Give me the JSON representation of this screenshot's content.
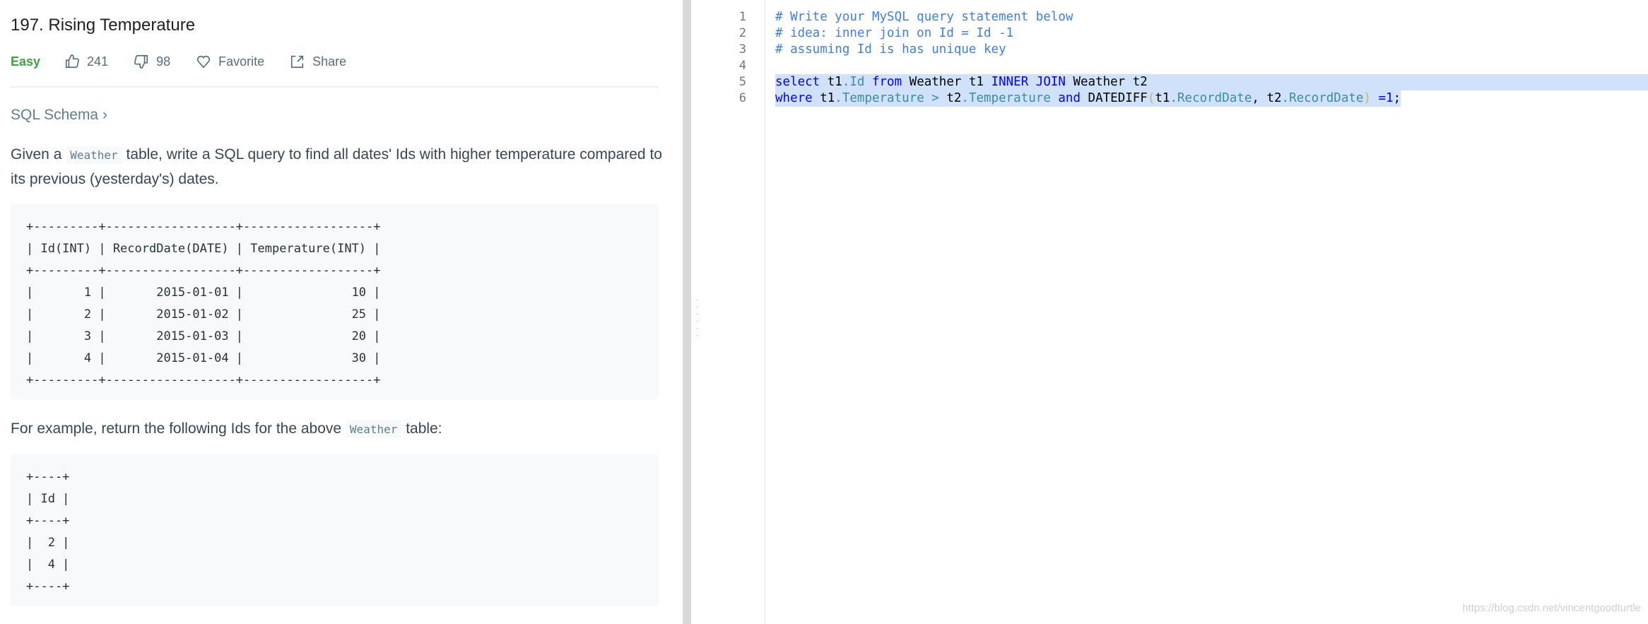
{
  "problem": {
    "title": "197. Rising Temperature",
    "difficulty": "Easy",
    "likes": "241",
    "dislikes": "98",
    "favorite_label": "Favorite",
    "share_label": "Share",
    "schema_link": "SQL Schema ›",
    "desc_before": "Given a ",
    "desc_code": "Weather",
    "desc_after": " table, write a SQL query to find all dates' Ids with higher temperature compared to its previous (yesterday's) dates.",
    "table_pre": "+---------+------------------+------------------+\n| Id(INT) | RecordDate(DATE) | Temperature(INT) |\n+---------+------------------+------------------+\n|       1 |       2015-01-01 |               10 |\n|       2 |       2015-01-02 |               25 |\n|       3 |       2015-01-03 |               20 |\n|       4 |       2015-01-04 |               30 |\n+---------+------------------+------------------+",
    "example_before": "For example, return the following Ids for the above ",
    "example_code": "Weather",
    "example_after": " table:",
    "result_pre": "+----+\n| Id |\n+----+\n|  2 |\n|  4 |\n+----+"
  },
  "editor": {
    "line_numbers": [
      "1",
      "2",
      "3",
      "4",
      "5",
      "6"
    ],
    "line1": "# Write your MySQL query statement below",
    "line2": "# idea: inner join on Id = Id -1",
    "line3": "# assuming Id is has unique key",
    "l5": [
      "select",
      " t1",
      ".Id",
      " from",
      " Weather t1 ",
      "INNER JOIN",
      " Weather t2"
    ],
    "l6": [
      "where",
      " t1",
      ".Temperature",
      " >",
      " t2",
      ".Temperature",
      " and",
      " DATEDIFF",
      "(",
      "t1",
      ".RecordDate",
      ", t2",
      ".RecordDate",
      ")",
      " =1",
      ";"
    ]
  },
  "watermark": "https://blog.csdn.net/vincentgoodturtle",
  "colors": {
    "easy": "#43a047",
    "comment": "#3f7fe0",
    "keyword": "#0000ff",
    "property": "#3b8d9a",
    "selection": "#d0e2fb"
  }
}
